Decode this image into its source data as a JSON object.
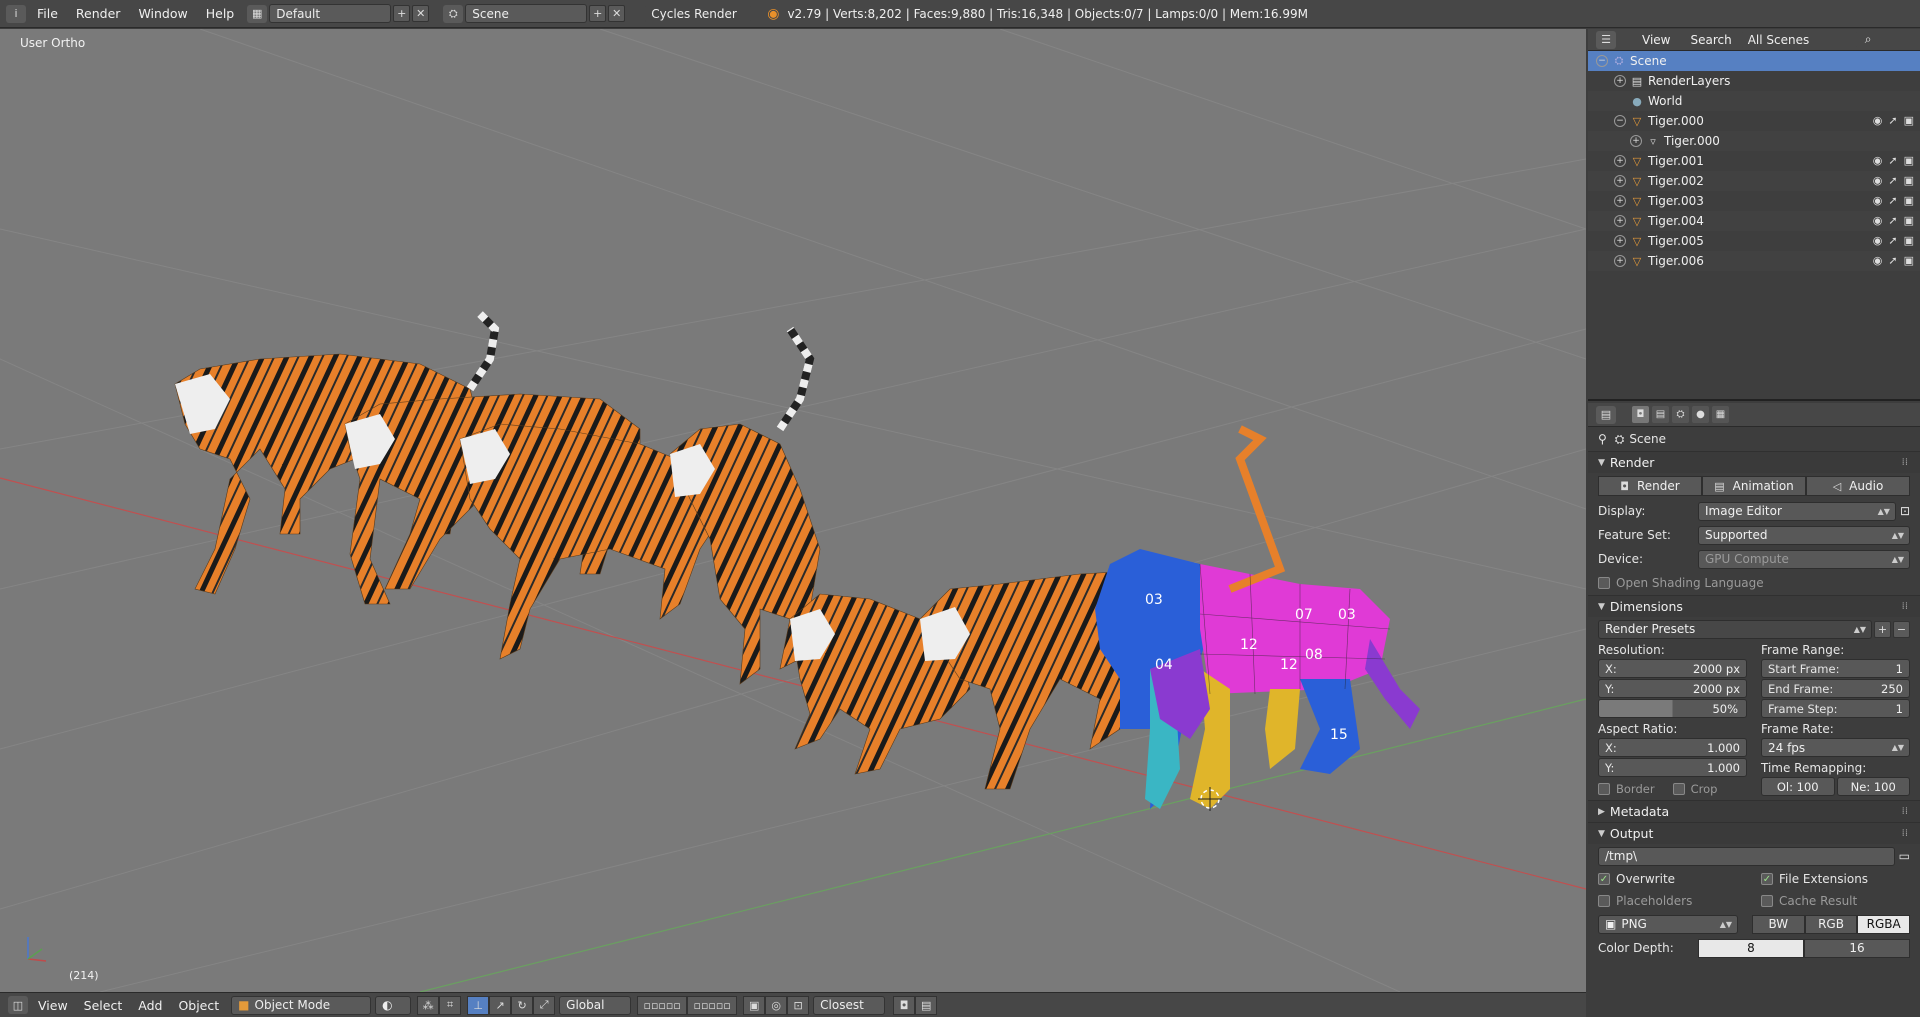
{
  "topbar": {
    "menus": [
      "File",
      "Render",
      "Window",
      "Help"
    ],
    "layout": "Default",
    "scene": "Scene",
    "engine": "Cycles Render",
    "stats": "v2.79 | Verts:8,202 | Faces:9,880 | Tris:16,348 | Objects:0/7 | Lamps:0/0 | Mem:16.99M"
  },
  "viewport": {
    "label": "User Ortho",
    "frame": "(214)",
    "header": {
      "menus": [
        "View",
        "Select",
        "Add",
        "Object"
      ],
      "mode": "Object Mode",
      "orientation": "Global",
      "snap": "Closest"
    },
    "uv_labels": [
      "03",
      "04",
      "12",
      "03",
      "07",
      "08",
      "15",
      "12"
    ]
  },
  "outliner": {
    "header": {
      "view": "View",
      "search": "Search",
      "filter": "All Scenes"
    },
    "rows": [
      {
        "label": "Scene",
        "sel": true
      },
      {
        "label": "RenderLayers"
      },
      {
        "label": "World"
      },
      {
        "label": "Tiger.000"
      },
      {
        "label": "Tiger.000"
      },
      {
        "label": "Tiger.001"
      },
      {
        "label": "Tiger.002"
      },
      {
        "label": "Tiger.003"
      },
      {
        "label": "Tiger.004"
      },
      {
        "label": "Tiger.005"
      },
      {
        "label": "Tiger.006"
      }
    ]
  },
  "props": {
    "context": "Scene",
    "render": {
      "title": "Render",
      "btn_render": "Render",
      "btn_anim": "Animation",
      "btn_audio": "Audio",
      "display_label": "Display:",
      "display": "Image Editor",
      "feature_label": "Feature Set:",
      "feature": "Supported",
      "device_label": "Device:",
      "device": "GPU Compute",
      "osl": "Open Shading Language"
    },
    "dimensions": {
      "title": "Dimensions",
      "presets": "Render Presets",
      "resolution": "Resolution:",
      "res_x_l": "X:",
      "res_x": "2000 px",
      "res_y_l": "Y:",
      "res_y": "2000 px",
      "res_pct": "50%",
      "frame_range": "Frame Range:",
      "start_l": "Start Frame:",
      "start": "1",
      "end_l": "End Frame:",
      "end": "250",
      "step_l": "Frame Step:",
      "step": "1",
      "aspect": "Aspect Ratio:",
      "asp_x_l": "X:",
      "asp_x": "1.000",
      "asp_y_l": "Y:",
      "asp_y": "1.000",
      "frame_rate": "Frame Rate:",
      "fps": "24 fps",
      "time_remap": "Time Remapping:",
      "old": "Ol: 100",
      "new": "Ne: 100",
      "border": "Border",
      "crop": "Crop"
    },
    "metadata": "Metadata",
    "output": {
      "title": "Output",
      "path": "/tmp\\",
      "overwrite": "Overwrite",
      "file_ext": "File Extensions",
      "placeholders": "Placeholders",
      "cache": "Cache Result",
      "format": "PNG",
      "bw": "BW",
      "rgb": "RGB",
      "rgba": "RGBA",
      "depth_label": "Color Depth:",
      "depth8": "8",
      "depth16": "16"
    }
  }
}
